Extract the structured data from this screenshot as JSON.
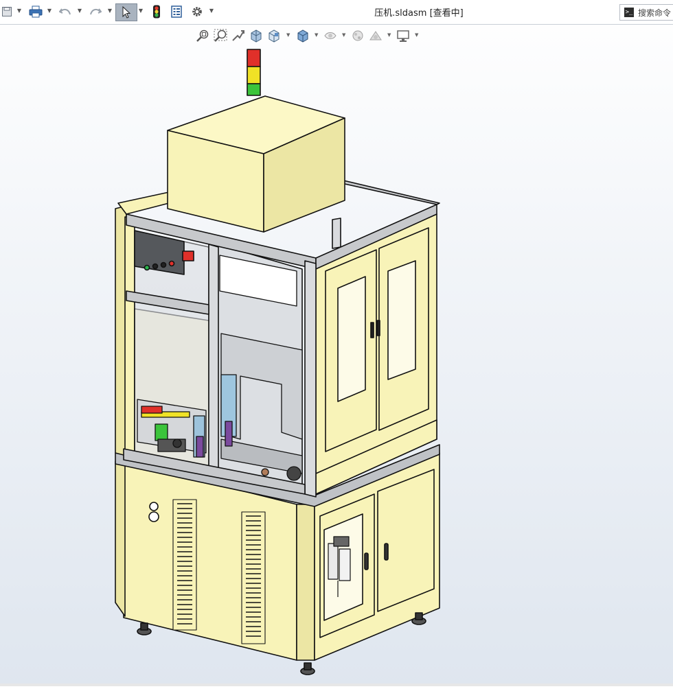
{
  "window": {
    "title": "压机.sldasm [查看中]"
  },
  "quick_access": {
    "items": [
      {
        "name": "save-icon"
      },
      {
        "name": "print-icon"
      },
      {
        "name": "undo-icon"
      },
      {
        "name": "redo-icon"
      },
      {
        "name": "select-cursor-icon"
      },
      {
        "name": "rebuild-traffic-light-icon"
      },
      {
        "name": "file-properties-icon"
      },
      {
        "name": "options-gear-icon"
      }
    ]
  },
  "command_search": {
    "placeholder": "搜索命令"
  },
  "view_toolbar": {
    "items": [
      {
        "name": "zoom-to-fit-icon"
      },
      {
        "name": "zoom-to-area-icon"
      },
      {
        "name": "previous-view-icon"
      },
      {
        "name": "section-view-icon"
      },
      {
        "name": "view-orientation-icon"
      },
      {
        "name": "display-style-icon"
      },
      {
        "name": "hide-show-items-icon"
      },
      {
        "name": "edit-appearance-icon"
      },
      {
        "name": "apply-scene-icon"
      },
      {
        "name": "view-settings-icon"
      }
    ]
  },
  "model": {
    "colors": {
      "panel": "#f8f3b8",
      "panel_shade": "#ece6a4",
      "outline": "#111111",
      "frame": "#c7c9cc",
      "glass_interior": "#dcdfe3",
      "signal_red": "#e0302a",
      "signal_yellow": "#f0e226",
      "signal_green": "#3bc43b",
      "background_top": "#ffffff",
      "background_bottom": "#dfe6ef"
    }
  }
}
